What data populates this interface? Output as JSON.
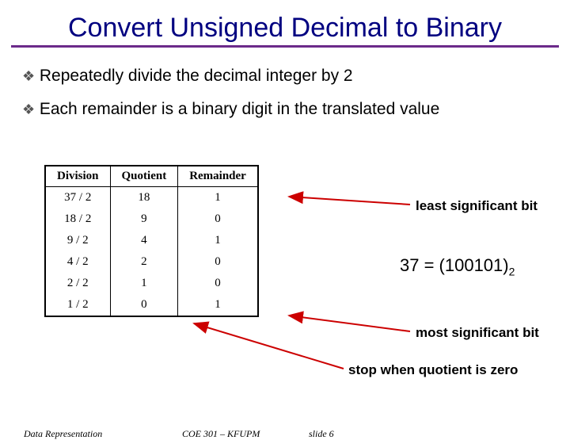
{
  "title": "Convert Unsigned Decimal to Binary",
  "bullets": [
    "Repeatedly divide the decimal integer by 2",
    "Each remainder is a binary digit in the translated value"
  ],
  "table": {
    "headers": [
      "Division",
      "Quotient",
      "Remainder"
    ],
    "rows": [
      [
        "37 / 2",
        "18",
        "1"
      ],
      [
        "18 / 2",
        "9",
        "0"
      ],
      [
        "9 / 2",
        "4",
        "1"
      ],
      [
        "4 / 2",
        "2",
        "0"
      ],
      [
        "2 / 2",
        "1",
        "0"
      ],
      [
        "1 / 2",
        "0",
        "1"
      ]
    ]
  },
  "annotations": {
    "lsb": "least significant bit",
    "msb": "most significant bit",
    "stop": "stop when quotient is zero",
    "result_prefix": "37 = (100101)",
    "result_sub": "2"
  },
  "footer": {
    "left": "Data Representation",
    "mid": "COE 301 – KFUPM",
    "slide": "slide 6"
  },
  "chart_data": {
    "type": "table",
    "title": "Convert Unsigned Decimal to Binary",
    "columns": [
      "Division",
      "Quotient",
      "Remainder"
    ],
    "rows": [
      [
        "37 / 2",
        18,
        1
      ],
      [
        "18 / 2",
        9,
        0
      ],
      [
        "9 / 2",
        4,
        1
      ],
      [
        "4 / 2",
        2,
        0
      ],
      [
        "2 / 2",
        1,
        0
      ],
      [
        "1 / 2",
        0,
        1
      ]
    ],
    "result": "37 = (100101)_2"
  }
}
